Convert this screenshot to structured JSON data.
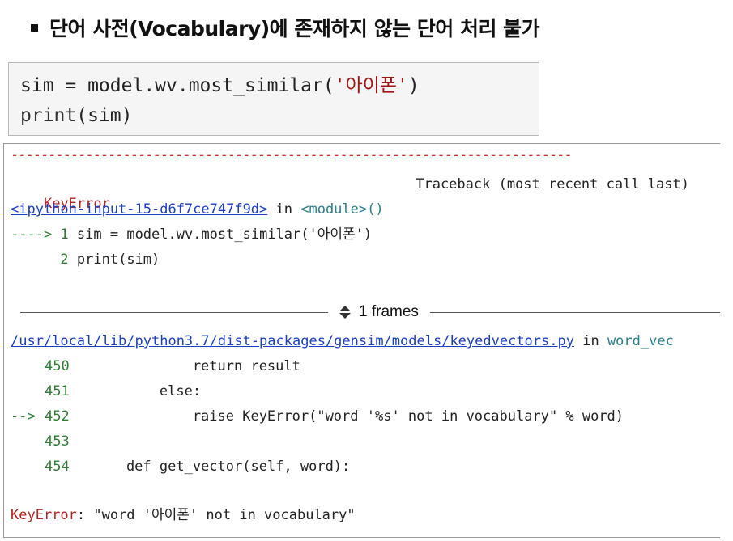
{
  "heading": "단어 사전(Vocabulary)에 존재하지 않는 단어 처리 불가",
  "code": {
    "line1_prefix": "sim = model.wv.most_similar(",
    "line1_string": "'아이폰'",
    "line1_suffix": ")",
    "line2_func": "print",
    "line2_args": "(sim)"
  },
  "output": {
    "separator": "---------------------------------------------------------------------------",
    "error_name": "KeyError",
    "traceback_label": "Traceback (most recent call last)",
    "input_link": "<ipython-input-15-d6f7ce747f9d>",
    "in_word": " in ",
    "module": "<module>()",
    "arrow1": "---->",
    "line1_no": "1",
    "line1_code": " sim = model.wv.most_similar('아이폰')",
    "line2_no": "2",
    "line2_code": " print(sim)",
    "frames_label": "1 frames",
    "file_link": "/usr/local/lib/python3.7/dist-packages/gensim/models/keyedvectors.py",
    "func_name": "word_vec",
    "lines": [
      {
        "arrow": "",
        "no": "450",
        "code": "            return result"
      },
      {
        "arrow": "",
        "no": "451",
        "code": "        else:"
      },
      {
        "arrow": "-->",
        "no": "452",
        "code": "            raise KeyError(\"word '%s' not in vocabulary\" % word)"
      },
      {
        "arrow": "",
        "no": "453",
        "code": ""
      },
      {
        "arrow": "",
        "no": "454",
        "code": "    def get_vector(self, word):"
      }
    ],
    "final_error_name": "KeyError",
    "final_error_msg": ": \"word '아이폰' not in vocabulary\""
  }
}
